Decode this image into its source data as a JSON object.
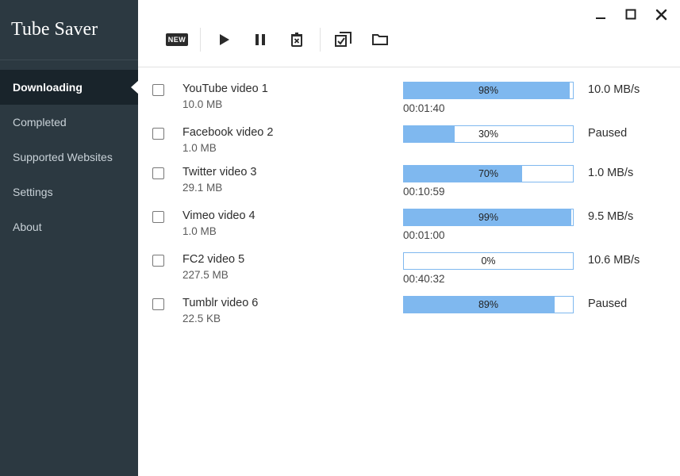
{
  "app_name": "Tube Saver",
  "colors": {
    "sidebar_bg": "#2c3941",
    "progress": "#7fb8ef"
  },
  "sidebar": {
    "items": [
      {
        "label": "Downloading",
        "active": true
      },
      {
        "label": "Completed",
        "active": false
      },
      {
        "label": "Supported Websites",
        "active": false
      },
      {
        "label": "Settings",
        "active": false
      },
      {
        "label": "About",
        "active": false
      }
    ]
  },
  "toolbar": {
    "new_label": "NEW",
    "icons": [
      "new-badge",
      "play",
      "pause",
      "delete",
      "check-multiple",
      "folder-open"
    ]
  },
  "downloads": [
    {
      "title": "YouTube video 1",
      "size": "10.0 MB",
      "progress": 98,
      "percent_label": "98%",
      "eta": "00:01:40",
      "status": "10.0 MB/s"
    },
    {
      "title": "Facebook video 2",
      "size": "1.0 MB",
      "progress": 30,
      "percent_label": "30%",
      "eta": "",
      "status": "Paused"
    },
    {
      "title": "Twitter video 3",
      "size": "29.1 MB",
      "progress": 70,
      "percent_label": "70%",
      "eta": "00:10:59",
      "status": "1.0 MB/s"
    },
    {
      "title": "Vimeo video 4",
      "size": "1.0 MB",
      "progress": 99,
      "percent_label": "99%",
      "eta": "00:01:00",
      "status": "9.5 MB/s"
    },
    {
      "title": "FC2 video 5",
      "size": "227.5 MB",
      "progress": 0,
      "percent_label": "0%",
      "eta": "00:40:32",
      "status": "10.6 MB/s"
    },
    {
      "title": "Tumblr video 6",
      "size": "22.5 KB",
      "progress": 89,
      "percent_label": "89%",
      "eta": "",
      "status": "Paused"
    }
  ]
}
